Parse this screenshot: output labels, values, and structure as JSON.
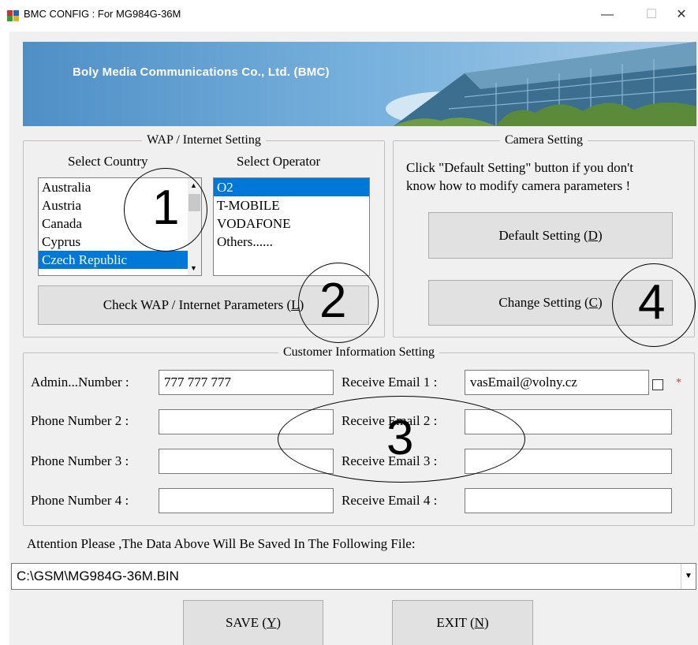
{
  "window": {
    "title": "BMC CONFIG : For MG984G-36M",
    "minimize": "—",
    "maximize": "☐",
    "close": "✕"
  },
  "banner": {
    "text": "Boly Media Communications Co., Ltd. (BMC)"
  },
  "wap": {
    "legend": "WAP / Internet Setting",
    "country_label": "Select Country",
    "operator_label": "Select Operator",
    "countries": [
      "Australia",
      "Austria",
      "Canada",
      "Cyprus",
      "Czech Republic"
    ],
    "selected_country": "Czech Republic",
    "operators": [
      "O2",
      "T-MOBILE",
      "VODAFONE",
      "Others......"
    ],
    "selected_operator": "O2",
    "check_button": "Check WAP / Internet Parameters (",
    "check_button_key": "L",
    "check_button_end": ")"
  },
  "camera": {
    "legend": "Camera Setting",
    "hint_line1": "Click \"Default Setting\" button if you don't",
    "hint_line2": "know how to modify camera parameters !",
    "default_button": "Default Setting (",
    "default_button_key": "D",
    "default_button_end": ")",
    "change_button": "Change Setting (",
    "change_button_key": "C",
    "change_button_end": ")"
  },
  "customer": {
    "legend": "Customer Information Setting",
    "phone_labels": [
      "Admin...Number :",
      "Phone Number 2 :",
      "Phone Number 3 :",
      "Phone Number 4 :"
    ],
    "phone_values": [
      "777 777 777",
      "",
      "",
      ""
    ],
    "email_labels": [
      "Receive Email 1 :",
      "Receive Email 2 :",
      "Receive Email 3 :",
      "Receive Email 4 :"
    ],
    "email_values": [
      "vasEmail@volny.cz",
      "",
      "",
      ""
    ],
    "required_mark": "*"
  },
  "file": {
    "attention": "Attention Please ,The Data Above Will Be Saved In The Following  File:",
    "path": "C:\\GSM\\MG984G-36M.BIN",
    "arrow": "▼"
  },
  "actions": {
    "save": "SAVE (",
    "save_key": "Y",
    "save_end": ")",
    "exit": "EXIT (",
    "exit_key": "N",
    "exit_end": ")"
  },
  "annotations": [
    "1",
    "2",
    "3",
    "4"
  ],
  "colors": {
    "selection": "#0078d7",
    "window_bg": "#f0f0f0",
    "banner_sky": "#5f9fd0"
  }
}
